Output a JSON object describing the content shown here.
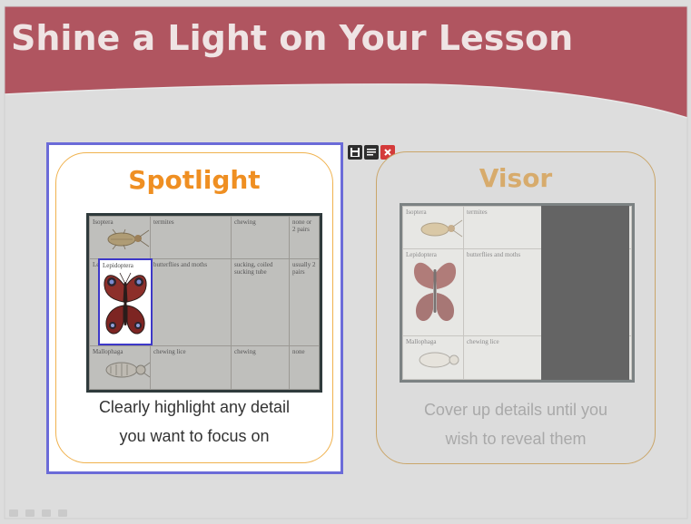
{
  "slide": {
    "title": "Shine a Light on Your Lesson"
  },
  "spotlight": {
    "heading": "Spotlight",
    "caption_line1": "Clearly highlight any detail",
    "caption_line2": "you want to focus on"
  },
  "visor": {
    "heading": "Visor",
    "caption_line1": "Cover up details until you",
    "caption_line2": "wish to reveal them"
  },
  "insect_table": {
    "rows": [
      {
        "order": "Isoptera",
        "common": "termites",
        "mouth": "chewing",
        "wings": "none or 2 pairs"
      },
      {
        "order": "Lepidoptera",
        "common": "butterflies and moths",
        "mouth": "sucking, coiled sucking tube",
        "wings": "usually 2 pairs"
      },
      {
        "order": "Mallophaga",
        "common": "chewing lice",
        "mouth": "chewing",
        "wings": "none"
      }
    ]
  },
  "toolbar": {
    "icons": [
      "save-icon",
      "menu-icon",
      "close-icon"
    ]
  },
  "nav_icons": [
    "prev-icon",
    "pen-icon",
    "menu-icon",
    "next-icon"
  ],
  "colors": {
    "banner": "#b05560",
    "background": "#dddddd",
    "spotlight_heading": "#ef8f22",
    "visor_heading": "#d7ab6c",
    "spotlight_frame": "#6b6bd8",
    "close_button": "#d43a3a"
  }
}
